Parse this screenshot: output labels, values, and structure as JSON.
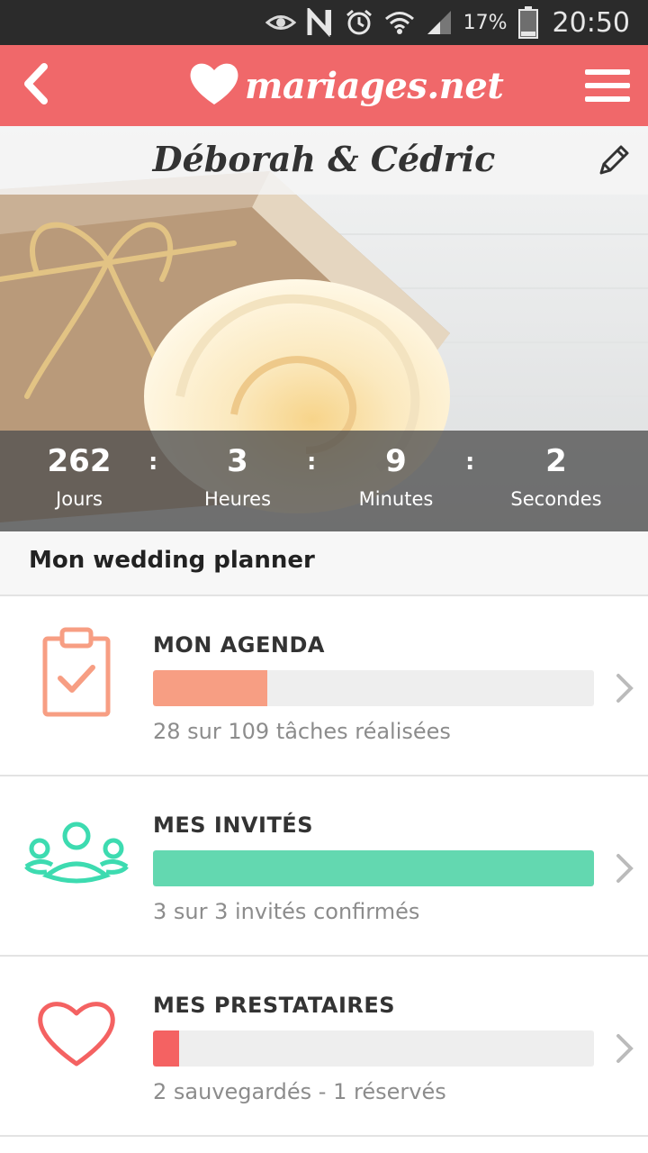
{
  "status_bar": {
    "battery_percent": "17%",
    "time": "20:50",
    "icons": [
      "eye-icon",
      "nfc-icon",
      "alarm-icon",
      "wifi-icon",
      "signal-icon",
      "battery-icon"
    ]
  },
  "header": {
    "logo_text": "mariages.net",
    "back_icon": "chevron-left-icon",
    "menu_icon": "hamburger-menu-icon",
    "background_color": "#f0686a"
  },
  "hero": {
    "couple_name": "Déborah & Cédric",
    "edit_icon": "pencil-icon",
    "countdown": [
      {
        "value": "262",
        "label": "Jours"
      },
      {
        "value": "3",
        "label": "Heures"
      },
      {
        "value": "9",
        "label": "Minutes"
      },
      {
        "value": "2",
        "label": "Secondes"
      }
    ],
    "separator": ":"
  },
  "planner": {
    "section_title": "Mon wedding planner",
    "items": [
      {
        "title": "MON AGENDA",
        "subtitle": "28 sur 109 tâches réalisées",
        "progress": 0.26,
        "color": "#f79e83",
        "icon": "clipboard-check-icon"
      },
      {
        "title": "MES INVITÉS",
        "subtitle": "3 sur 3 invités confirmés",
        "progress": 1.0,
        "color": "#63d8b0",
        "icon": "people-group-icon"
      },
      {
        "title": "MES PRESTATAIRES",
        "subtitle": "2 sauvegardés - 1 réservés",
        "progress": 0.06,
        "color": "#f46262",
        "icon": "heart-icon"
      }
    ]
  }
}
